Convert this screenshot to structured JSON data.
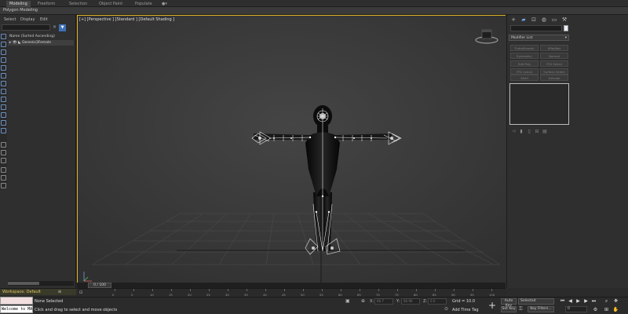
{
  "ribbon": {
    "tabs": [
      "Modeling",
      "Freeform",
      "Selection",
      "Object Paint",
      "Populate"
    ],
    "active_tab": "Modeling",
    "subtitle": "Polygon Modeling"
  },
  "explorer": {
    "menu": [
      "Select",
      "Display",
      "Edit"
    ],
    "column_header": "Name (Sorted Ascending)",
    "row_label": "Genesis3Female",
    "search_placeholder": ""
  },
  "viewport": {
    "label": "[+] [Perspective ] [Standard ] [Default Shading ]",
    "border_color": "#e0b428"
  },
  "command_panel": {
    "modifier_list": "Modifier List",
    "buttons": [
      "TurboSmooth",
      "VRayBox",
      "Symmetry",
      "Normal",
      "Edit Poly",
      "FFD Select",
      "FFD 4x4x4",
      "Surface Select",
      "Shell",
      "Extrude"
    ]
  },
  "workspace": {
    "label": "Workspace: Default"
  },
  "timeslider": {
    "thumb_label": "0 / 100",
    "ticks": [
      "0",
      "5",
      "10",
      "15",
      "20",
      "25",
      "30",
      "35",
      "40",
      "45",
      "50",
      "55",
      "60",
      "65",
      "70",
      "75",
      "80",
      "85",
      "90",
      "95",
      "100"
    ]
  },
  "status": {
    "maxscript_output": "Welcome to MAXScript",
    "selection": "None Selected",
    "prompt": "Click and drag to select and move objects",
    "x_label": "X:",
    "y_label": "Y:",
    "z_label": "Z:",
    "x_value": "66.7",
    "y_value": "66.96",
    "z_value": "0.0",
    "grid": "Grid = 10.0",
    "add_time_tag": "Add Time Tag",
    "auto_key": "Auto Key",
    "set_key": "Set Key",
    "selected": "Selected",
    "key_filters": "Key Filters...",
    "frame": "0"
  }
}
